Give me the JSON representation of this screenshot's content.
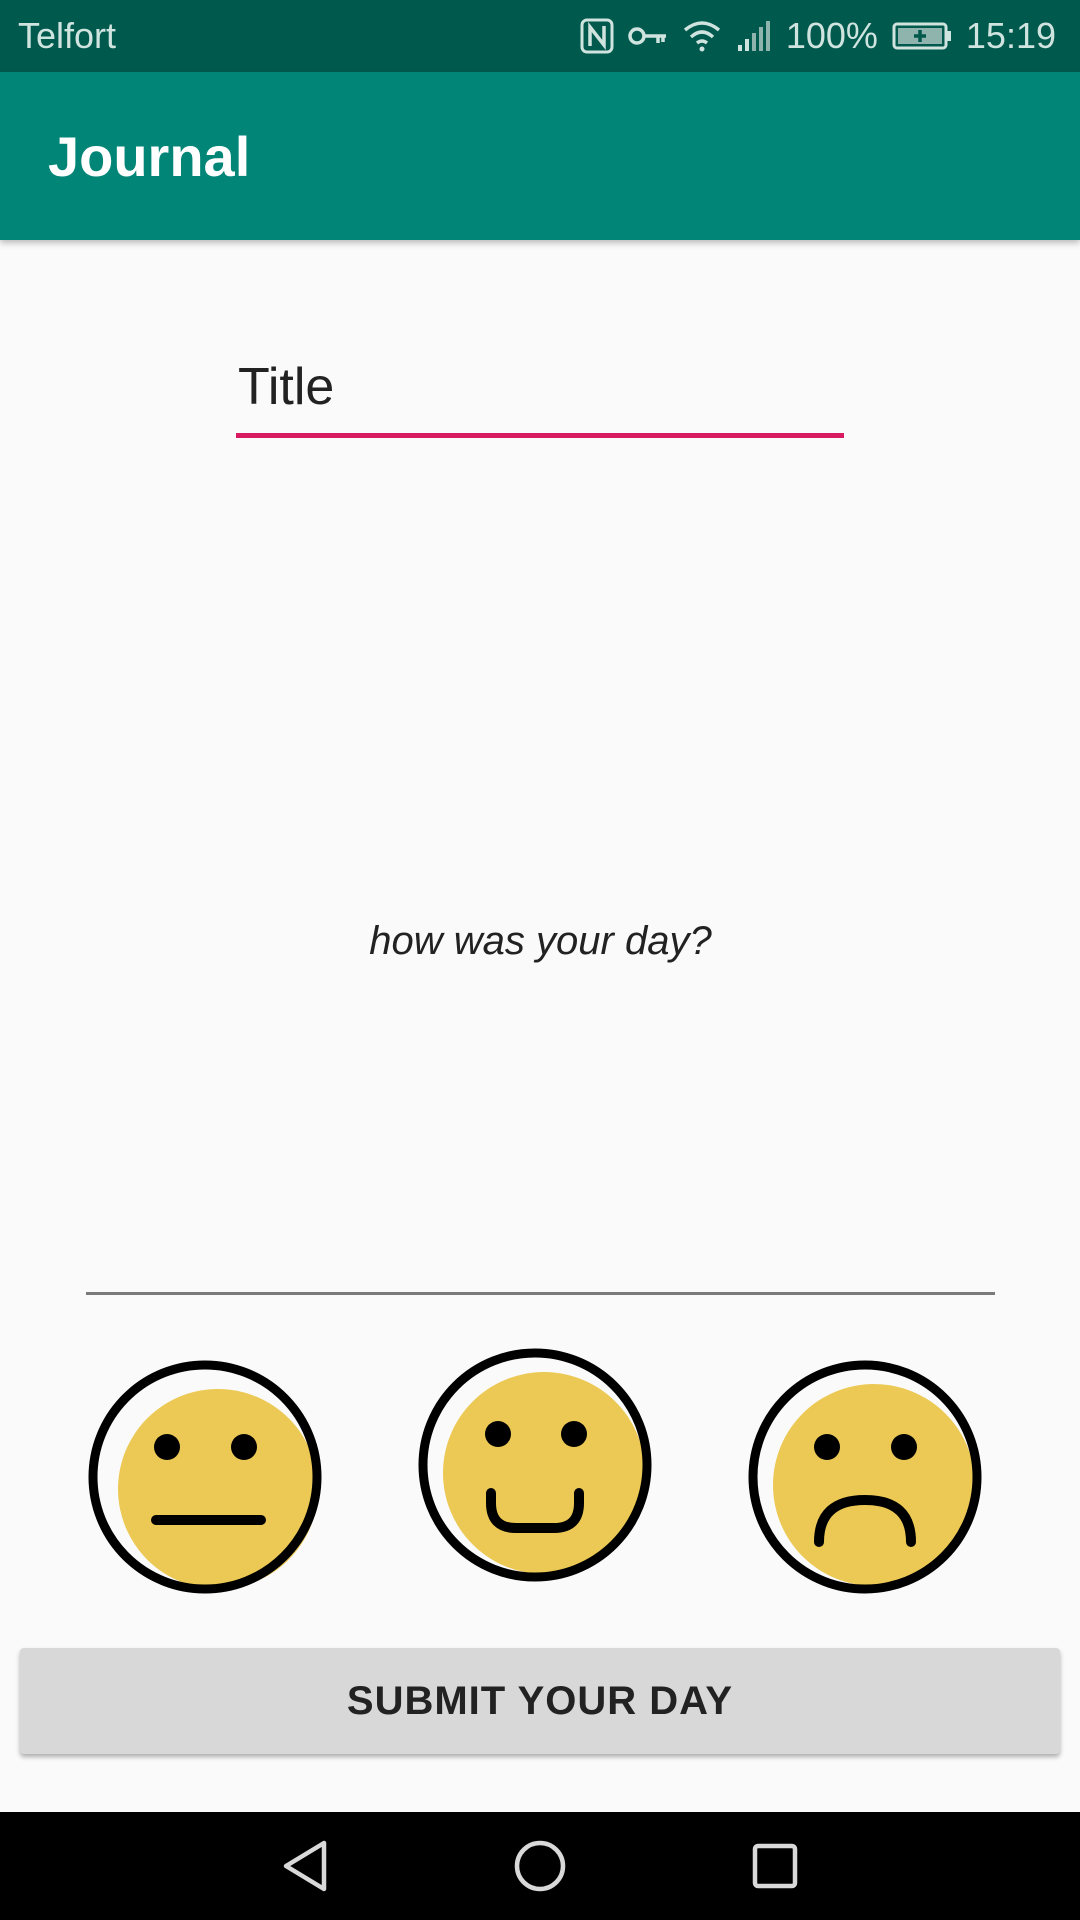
{
  "status_bar": {
    "carrier": "Telfort",
    "battery": "100%",
    "time": "15:19",
    "icons": [
      "nfc-icon",
      "vpn-key-icon",
      "wifi-icon",
      "signal-icon",
      "battery-charging-icon"
    ]
  },
  "app_bar": {
    "title": "Journal"
  },
  "form": {
    "title_placeholder": "Title",
    "body_placeholder": "how was your day?",
    "accent_color": "#d81b60"
  },
  "moods": [
    {
      "name": "neutral",
      "icon": "neutral-face-icon"
    },
    {
      "name": "happy",
      "icon": "happy-face-icon"
    },
    {
      "name": "sad",
      "icon": "sad-face-icon"
    }
  ],
  "submit_label": "SUBMIT YOUR DAY",
  "nav_bar": {
    "icons": [
      "back-icon",
      "home-icon",
      "recents-icon"
    ]
  },
  "colors": {
    "primary": "#008577",
    "primary_dark": "#00574b",
    "face_fill": "#ecc955"
  }
}
